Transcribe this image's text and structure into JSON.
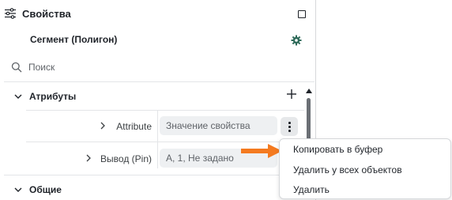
{
  "panel": {
    "title": "Свойства",
    "object_title": "Сегмент (Полигон)",
    "search": {
      "placeholder": "Поиск",
      "value": ""
    }
  },
  "sections": {
    "attributes": {
      "label": "Атрибуты"
    },
    "general": {
      "label": "Общие"
    }
  },
  "rows": [
    {
      "label": "Attribute",
      "value": "Значение свойства"
    },
    {
      "label": "Вывод (Pin)",
      "value": "A, 1, Не задано"
    }
  ],
  "context_menu": {
    "items": [
      {
        "label": "Копировать в буфер"
      },
      {
        "label": "Удалить у всех объектов"
      },
      {
        "label": "Удалить"
      }
    ]
  },
  "colors": {
    "arrow": "#f47a20",
    "gear": "#2f6b5a",
    "value_bg": "#eef0f2",
    "scroll_thumb": "#6b6f75"
  },
  "icons": [
    "sliders-icon",
    "maximize-icon",
    "settings-gear-icon",
    "search-icon",
    "chevron-down-icon",
    "chevron-right-icon",
    "plus-icon",
    "kebab-menu-icon",
    "arrow-right-icon"
  ]
}
